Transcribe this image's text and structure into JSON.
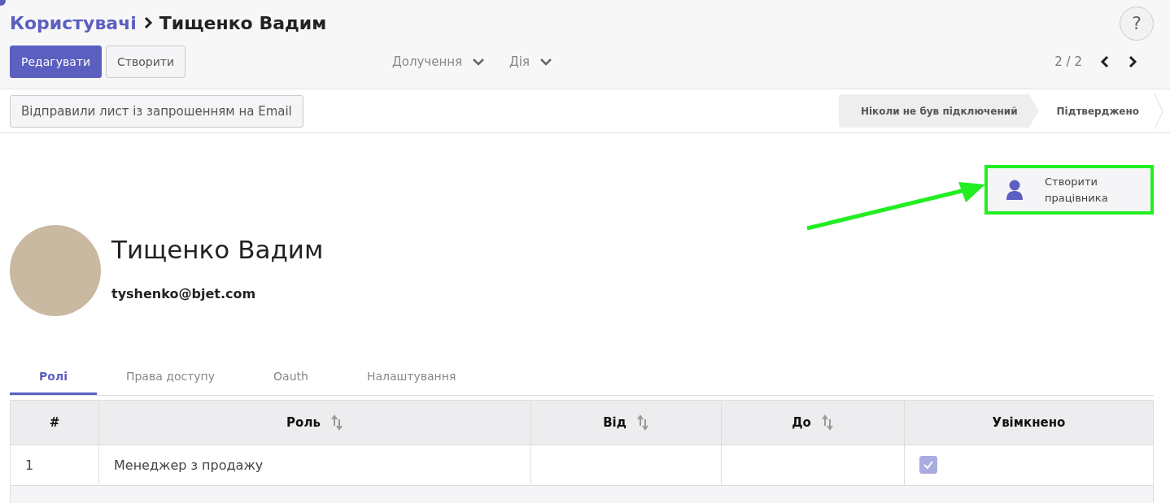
{
  "breadcrumb": {
    "parent": "Користувачі",
    "current": "Тищенко Вадим"
  },
  "help_button": "?",
  "toolbar": {
    "buttons": [
      {
        "label": "Редагувати",
        "kind": "primary"
      },
      {
        "label": "Створити",
        "kind": "secondary"
      }
    ],
    "dropdowns": [
      "Долучення",
      "Дія"
    ],
    "pager": "2 / 2"
  },
  "header": {
    "action_button": "Відправили лист із запрошенням на Email",
    "stages": [
      {
        "label": "Ніколи не був підключений",
        "selected": true
      },
      {
        "label": "Підтверджено",
        "selected": false
      }
    ]
  },
  "smart_button": {
    "label": "Створити працівника",
    "highlighted": true
  },
  "profile": {
    "name": "Тищенко Вадим",
    "email": "tyshenko@bjet.com"
  },
  "tabs": [
    {
      "label": "Ролі",
      "selected": true
    },
    {
      "label": "Права доступу",
      "selected": false
    },
    {
      "label": "Oauth",
      "selected": false
    },
    {
      "label": "Налаштування",
      "selected": false
    }
  ],
  "table": {
    "columns": [
      {
        "label": "#",
        "sortable": false
      },
      {
        "label": "Роль",
        "sortable": true
      },
      {
        "label": "Від",
        "sortable": true
      },
      {
        "label": "До",
        "sortable": true
      },
      {
        "label": "Увімкнено",
        "sortable": false
      }
    ],
    "rows": [
      {
        "number": "1",
        "role": "Менеджер з продажу",
        "enabled": true
      }
    ]
  }
}
